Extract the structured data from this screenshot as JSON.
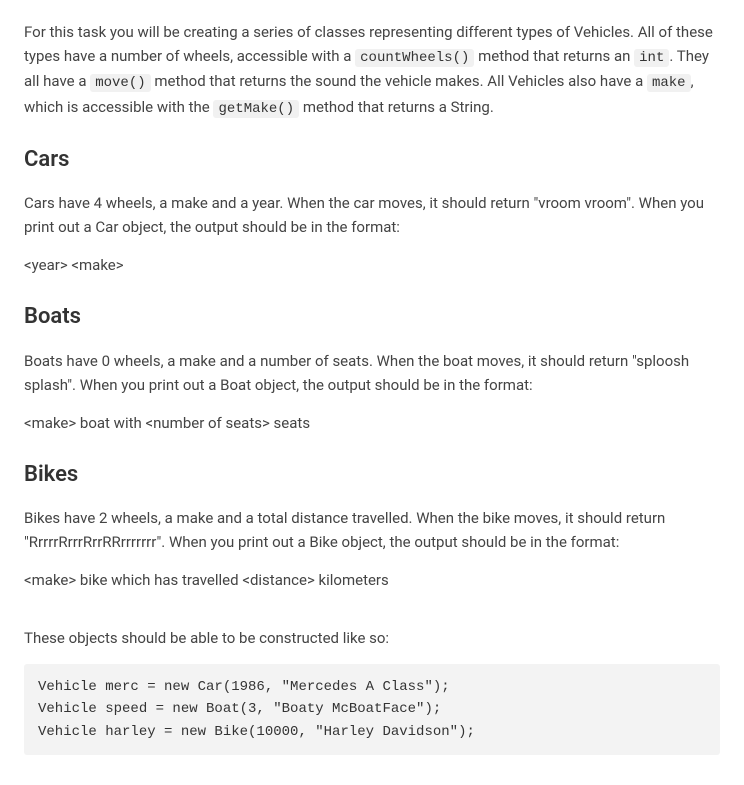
{
  "intro": {
    "part1": "For this task you will be creating a series of classes representing different types of Vehicles. All of these types have a number of wheels, accessible with a ",
    "code1": "countWheels()",
    "part2": " method that returns an ",
    "code2": "int",
    "part3": ". They all have a ",
    "code3": "move()",
    "part4": " method that returns the sound the vehicle makes. All Vehicles also have a ",
    "code4": "make",
    "part5": ", which is accessible with the ",
    "code5": "getMake()",
    "part6": " method that returns a String."
  },
  "cars": {
    "heading": "Cars",
    "desc": "Cars have 4 wheels, a make and a year. When the car moves, it should return \"vroom vroom\". When you print out a Car object, the output should be in the format:",
    "format": "<year> <make>"
  },
  "boats": {
    "heading": "Boats",
    "desc": "Boats have 0 wheels, a make and a number of seats. When the boat moves, it should return \"sploosh splash\". When you print out a Boat object, the output should be in the format:",
    "format": "<make> boat with <number of seats> seats"
  },
  "bikes": {
    "heading": "Bikes",
    "desc": "Bikes have 2 wheels, a make and a total distance travelled. When the bike moves, it should return \"RrrrrRrrrRrrRRrrrrrrr\". When you print out a Bike object, the output should be in the format:",
    "format": "<make> bike which has travelled <distance> kilometers"
  },
  "construction": {
    "lead": "These objects should be able to be constructed like so:",
    "code": "Vehicle merc = new Car(1986, \"Mercedes A Class\");\nVehicle speed = new Boat(3, \"Boaty McBoatFace\");\nVehicle harley = new Bike(10000, \"Harley Davidson\");"
  }
}
